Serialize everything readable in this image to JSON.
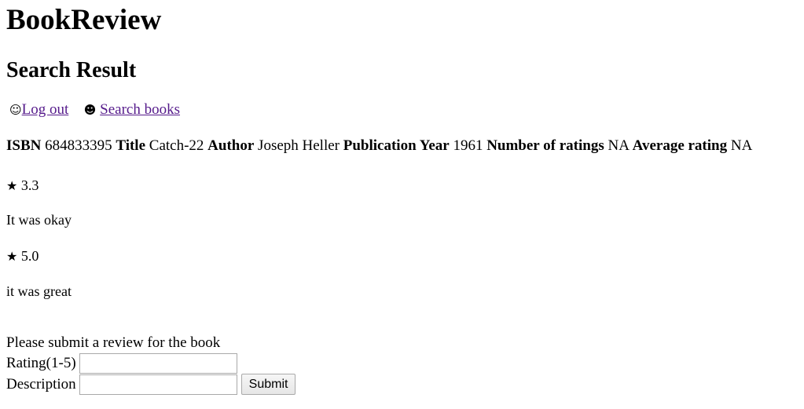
{
  "app": {
    "title": "BookReview"
  },
  "page": {
    "title": "Search Result"
  },
  "nav": {
    "logout_icon": "☺",
    "logout_label": "Log out",
    "search_icon": "☻",
    "search_label": "Search books"
  },
  "book": {
    "isbn_label": "ISBN",
    "isbn": "684833395",
    "title_label": "Title",
    "title": "Catch-22",
    "author_label": "Author",
    "author": "Joseph Heller",
    "year_label": "Publication Year",
    "year": "1961",
    "num_ratings_label": "Number of ratings",
    "num_ratings": "NA",
    "avg_rating_label": "Average rating",
    "avg_rating": "NA"
  },
  "reviews": [
    {
      "star": "★",
      "rating": "3.3",
      "text": "It was okay"
    },
    {
      "star": "★",
      "rating": "5.0",
      "text": "it was great"
    }
  ],
  "review_form": {
    "intro": "Please submit a review for the book",
    "rating_label": "Rating(1-5)",
    "rating_value": "",
    "description_label": "Description",
    "description_value": "",
    "submit_label": "Submit"
  }
}
